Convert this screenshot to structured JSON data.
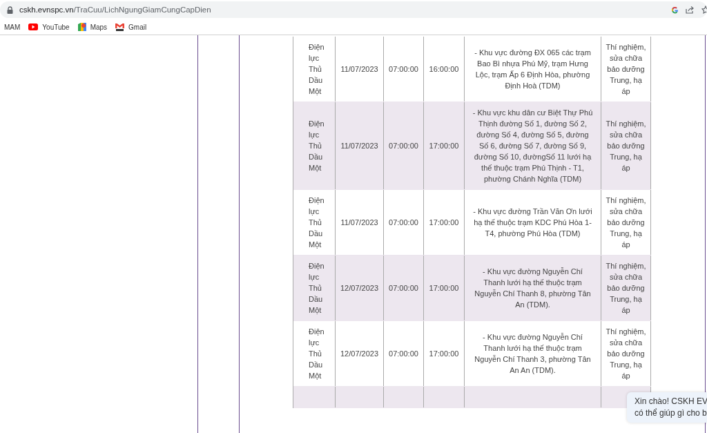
{
  "browser": {
    "url_host": "cskh.evnspc.vn",
    "url_path": "/TraCuu/LichNgungGiamCungCapDien"
  },
  "bookmarks": [
    {
      "label": "MAM",
      "kind": "text"
    },
    {
      "label": "YouTube",
      "kind": "youtube"
    },
    {
      "label": "Maps",
      "kind": "maps"
    },
    {
      "label": "Gmail",
      "kind": "gmail"
    }
  ],
  "table": {
    "rows": [
      {
        "unit": "Điện lực Thủ Dầu Một",
        "date": "11/07/2023",
        "start": "07:00:00",
        "end": "16:00:00",
        "area": "- Khu vực đường ĐX 065 các trạm Bao Bì nhựa Phú Mỹ, trạm Hưng Lộc, trạm Ấp 6 Định Hòa, phường Định Hoà (TDM)",
        "reason": "Thí nghiệm, sửa chữa bảo dưỡng Trung, hạ áp"
      },
      {
        "unit": "Điện lực Thủ Dầu Một",
        "date": "11/07/2023",
        "start": "07:00:00",
        "end": "17:00:00",
        "area": "- Khu vực khu dân cư Biệt Thự Phú Thịnh đường Số 1, đường Số 2, đường Số 4, đường Số 5, đường Số 6, đường Số 7, đường Số 9, đường Số 10, đườngSố 11 lưới hạ thế thuộc trạm Phú Thịnh - T1, phường Chánh Nghĩa (TDM)",
        "reason": "Thí nghiệm, sửa chữa bảo dưỡng Trung, hạ áp"
      },
      {
        "unit": "Điện lực Thủ Dầu Một",
        "date": "11/07/2023",
        "start": "07:00:00",
        "end": "17:00:00",
        "area": "- Khu vực đường Trần Văn Ơn lưới hạ thế thuộc trạm KDC Phú Hòa 1-T4, phường Phú Hòa (TDM)",
        "reason": "Thí nghiệm, sửa chữa bảo dưỡng Trung, hạ áp"
      },
      {
        "unit": "Điện lực Thủ Dầu Một",
        "date": "12/07/2023",
        "start": "07:00:00",
        "end": "17:00:00",
        "area": "- Khu vực đường Nguyễn Chí Thanh lưới hạ thế thuộc trạm Nguyễn Chí Thanh 8, phường Tân An (TDM).",
        "reason": "Thí nghiệm, sửa chữa bảo dưỡng Trung, hạ áp"
      },
      {
        "unit": "Điện lực Thủ Dầu Một",
        "date": "12/07/2023",
        "start": "07:00:00",
        "end": "17:00:00",
        "area": "- Khu vực đường Nguyễn Chí Thanh lưới hạ thế thuộc trạm Nguyễn Chí Thanh 3, phường Tân An An (TDM).",
        "reason": "Thí nghiệm, sửa chữa bảo dưỡng Trung, hạ áp"
      }
    ]
  },
  "chat_popup": {
    "lines": [
      "Xin chào! CSKH EV",
      "có thể giúp gì cho b"
    ]
  }
}
